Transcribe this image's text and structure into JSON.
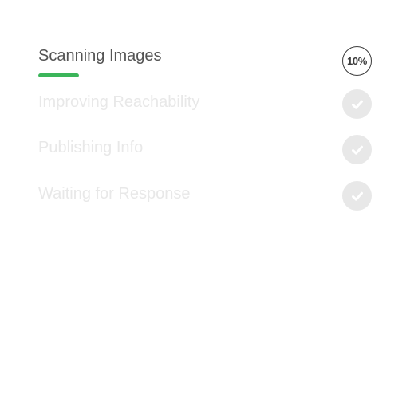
{
  "steps": [
    {
      "label": "Scanning Images",
      "state": "active",
      "progress_percent": 10,
      "badge_text": "10%",
      "icon": "percent-badge"
    },
    {
      "label": "Improving Reachability",
      "state": "done",
      "icon": "check-circle-icon"
    },
    {
      "label": "Publishing Info",
      "state": "done",
      "icon": "check-circle-icon"
    },
    {
      "label": "Waiting for Response",
      "state": "done",
      "icon": "check-circle-icon"
    }
  ],
  "colors": {
    "active_text": "#545454",
    "inactive_text": "#e8e8e8",
    "progress": "#3bb55a",
    "badge_border": "#3a3a3a",
    "check_bg": "#e8e8e8",
    "check_mark": "#ffffff"
  }
}
